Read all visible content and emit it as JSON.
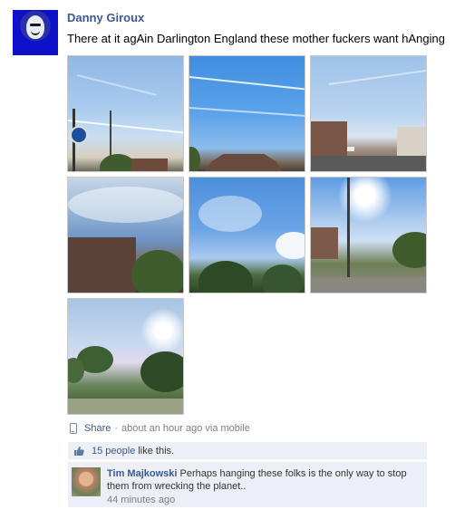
{
  "post": {
    "author": "Danny Giroux",
    "message": "There at it agAin Darlington England these mother fuckers want hAnging",
    "photos": [
      {
        "name": "photo-contrails-sign"
      },
      {
        "name": "photo-contrails-roof"
      },
      {
        "name": "photo-street-houses"
      },
      {
        "name": "photo-cloudy-houses"
      },
      {
        "name": "photo-clouds-trees"
      },
      {
        "name": "photo-street-sun"
      },
      {
        "name": "photo-park-sun"
      }
    ],
    "actions": {
      "share_label": "Share",
      "separator": "·",
      "timestamp": "about an hour ago via mobile"
    }
  },
  "likes": {
    "count_text": "15 people",
    "suffix": "like this."
  },
  "comment": {
    "author": "Tim Majkowski",
    "text": "Perhaps hanging these folks is the only way to stop them from wrecking the planet..",
    "time": "44 minutes ago"
  },
  "colors": {
    "link": "#3b5998",
    "muted": "#808080",
    "panel": "#eceff5"
  }
}
